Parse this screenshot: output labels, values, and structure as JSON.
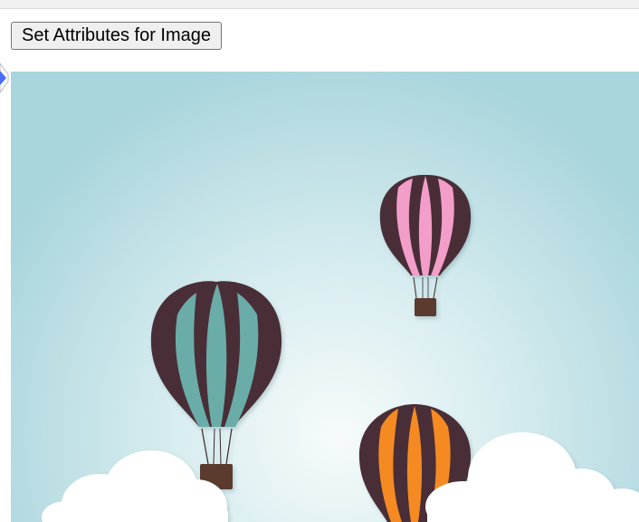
{
  "toolbar": {
    "set_attributes_label": "Set Attributes for Image"
  },
  "image": {
    "subject": "hot air balloons above clouds",
    "icon": "hot-air-balloon-illustration",
    "colors": {
      "sky_center": "#f7fbfb",
      "sky_edge": "#a9d5dc",
      "balloon_dark": "#4a2e38",
      "balloon_pink": "#f29ec8",
      "balloon_teal": "#6aaca8",
      "balloon_orange": "#f58a22",
      "basket": "#5a3a2e",
      "cloud": "#ffffff"
    }
  }
}
